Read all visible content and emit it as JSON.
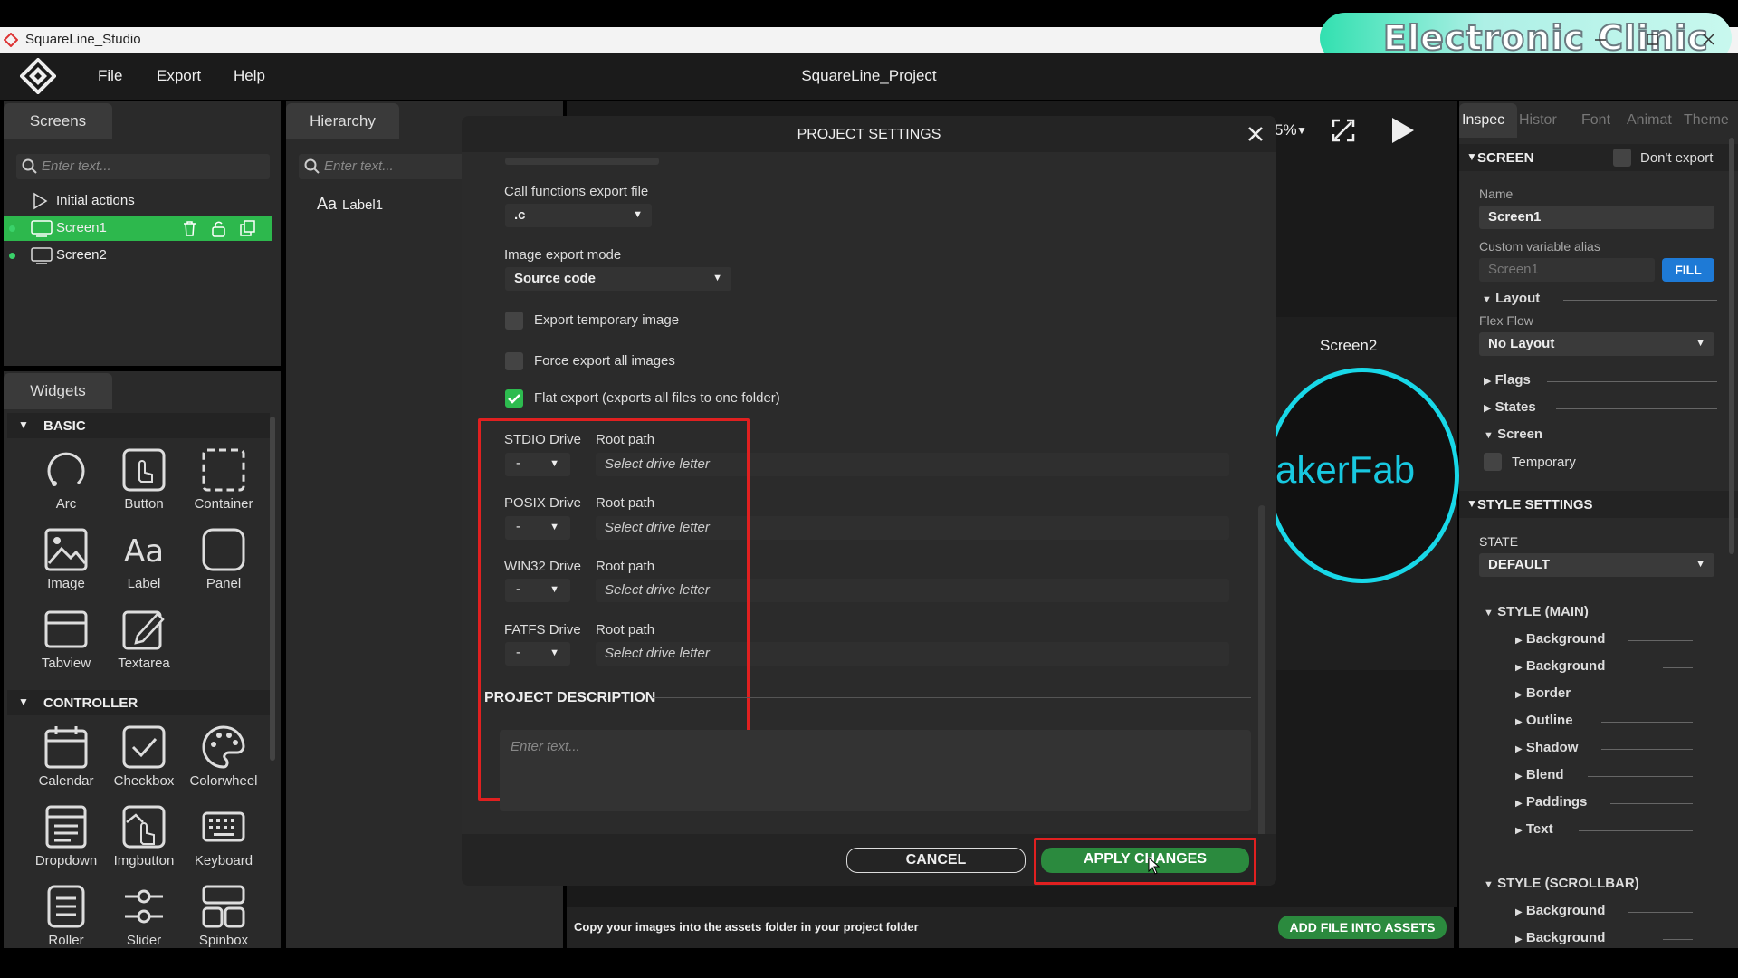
{
  "window": {
    "title": "SquareLine_Studio",
    "project": "SquareLine_Project"
  },
  "watermark": "Electronic Clinic",
  "menu": {
    "file": "File",
    "export": "Export",
    "help": "Help"
  },
  "screens": {
    "tab": "Screens",
    "search_placeholder": "Enter text...",
    "items": [
      {
        "label": "Initial actions"
      },
      {
        "label": "Screen1"
      },
      {
        "label": "Screen2"
      }
    ]
  },
  "hierarchy": {
    "tab": "Hierarchy",
    "search_placeholder": "Enter text...",
    "items": [
      {
        "label": "Label1"
      }
    ]
  },
  "widgets": {
    "tab": "Widgets",
    "basic": {
      "title": "BASIC",
      "items": [
        "Arc",
        "Button",
        "Container",
        "Image",
        "Label",
        "Panel",
        "Tabview",
        "Textarea"
      ]
    },
    "controller": {
      "title": "CONTROLLER",
      "items": [
        "Calendar",
        "Checkbox",
        "Colorwheel",
        "Dropdown",
        "Imgbutton",
        "Keyboard",
        "Roller",
        "Slider",
        "Spinbox"
      ]
    }
  },
  "toolbar": {
    "zoom": "5%"
  },
  "canvas": {
    "screen_label": "Screen2",
    "text": "akerFab"
  },
  "modal": {
    "title": "PROJECT SETTINGS",
    "call_functions": {
      "label": "Call functions export file",
      "value": ".c"
    },
    "image_export": {
      "label": "Image export mode",
      "value": "Source code"
    },
    "options": [
      {
        "label": "Export temporary image",
        "checked": false
      },
      {
        "label": "Force export all images",
        "checked": false
      },
      {
        "label": "Flat export (exports all files to one folder)",
        "checked": true
      }
    ],
    "drives": [
      {
        "label": "STDIO Drive",
        "root": "Root path",
        "value": "-",
        "placeholder": "Select drive letter"
      },
      {
        "label": "POSIX Drive",
        "root": "Root path",
        "value": "-",
        "placeholder": "Select drive letter"
      },
      {
        "label": "WIN32 Drive",
        "root": "Root path",
        "value": "-",
        "placeholder": "Select drive letter"
      },
      {
        "label": "FATFS Drive",
        "root": "Root path",
        "value": "-",
        "placeholder": "Select drive letter"
      }
    ],
    "description": {
      "title": "PROJECT DESCRIPTION",
      "placeholder": "Enter text..."
    },
    "cancel": "CANCEL",
    "apply": "APPLY CHANGES"
  },
  "assets": {
    "hint": "Copy your images into the assets folder in your project folder",
    "add": "ADD FILE INTO ASSETS"
  },
  "inspector": {
    "tabs": [
      "Inspec",
      "Histor",
      "Font",
      "Animat",
      "Theme"
    ],
    "screen_title": "SCREEN",
    "dont_export": "Don't export",
    "name_label": "Name",
    "name_value": "Screen1",
    "alias_label": "Custom variable alias",
    "alias_value": "Screen1",
    "fill": "FILL",
    "layout": "Layout",
    "flex_flow": "Flex Flow",
    "flex_value": "No Layout",
    "flags": "Flags",
    "states": "States",
    "screen": "Screen",
    "temporary": "Temporary",
    "style_settings": "STYLE SETTINGS",
    "state_label": "STATE",
    "state_value": "DEFAULT",
    "style_main": "STYLE (MAIN)",
    "main_items": [
      "Background",
      "Background",
      "Border",
      "Outline",
      "Shadow",
      "Blend",
      "Paddings",
      "Text"
    ],
    "style_scrollbar": "STYLE (SCROLLBAR)",
    "scroll_items": [
      "Background",
      "Background"
    ]
  }
}
